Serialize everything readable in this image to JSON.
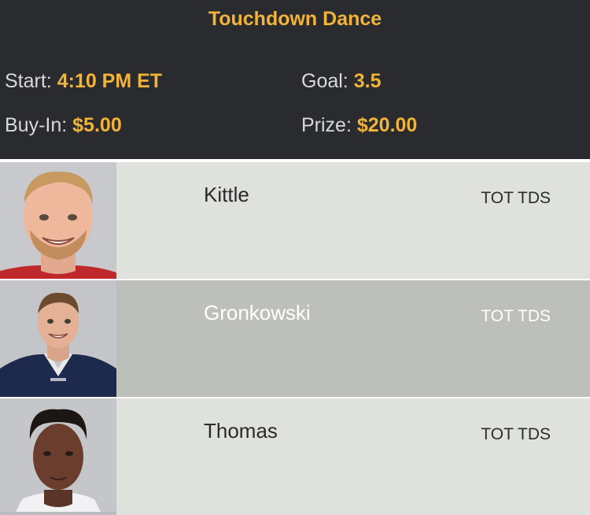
{
  "contest": {
    "title": "Touchdown Dance",
    "start_label": "Start:",
    "start_value": "4:10 PM ET",
    "goal_label": "Goal:",
    "goal_value": "3.5",
    "buyin_label": "Buy-In:",
    "buyin_value": "$5.00",
    "prize_label": "Prize:",
    "prize_value": "$20.00"
  },
  "players": [
    {
      "name": "Kittle",
      "stat": "TOT TDS",
      "photo": "player-photo-kittle"
    },
    {
      "name": "Gronkowski",
      "stat": "TOT TDS",
      "photo": "player-photo-gronkowski"
    },
    {
      "name": "Thomas",
      "stat": "TOT TDS",
      "photo": "player-photo-thomas"
    }
  ],
  "colors": {
    "header_bg": "#2a2b2e",
    "accent": "#f1b338",
    "row_light": "#dfe1dc",
    "row_dark": "#bcbfba"
  }
}
